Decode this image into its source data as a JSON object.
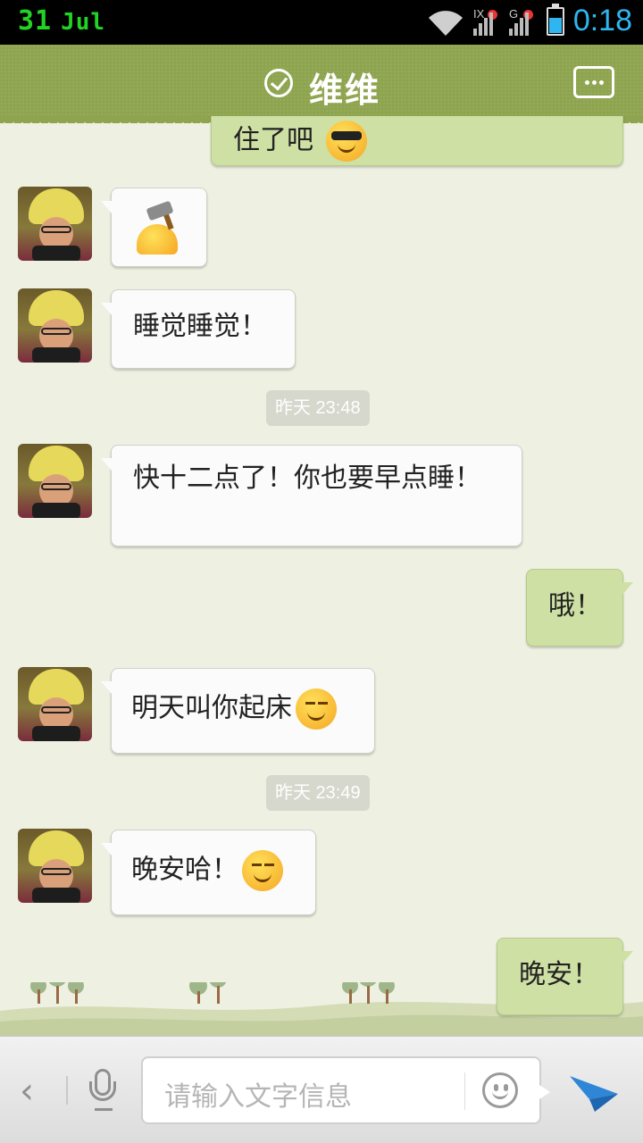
{
  "status_bar": {
    "date_day": "31",
    "date_month": "Jul",
    "signal_label_1": "IX",
    "signal_label_2": "G",
    "time": "0:18",
    "battery_level": 0.6
  },
  "header": {
    "contact_name": "维维",
    "verified_icon": "check-circle-icon",
    "menu_icon": "more-options-icon"
  },
  "messages": [
    {
      "side": "right",
      "text": "住了吧",
      "emoji": "cool-emoji",
      "partial": true
    },
    {
      "side": "left",
      "text": "",
      "emoji": "hammer-knock-emoji"
    },
    {
      "side": "left",
      "text": "睡觉睡觉！"
    },
    {
      "type": "timestamp",
      "text": "昨天 23:48"
    },
    {
      "side": "left",
      "text": "快十二点了！你也要早点睡！"
    },
    {
      "side": "right",
      "text": "哦！"
    },
    {
      "side": "left",
      "text": "明天叫你起床",
      "emoji": "sleepy-smile-emoji"
    },
    {
      "type": "timestamp",
      "text": "昨天 23:49"
    },
    {
      "side": "left",
      "text": "晚安哈！",
      "emoji": "content-smile-emoji"
    },
    {
      "side": "right",
      "text": "晚安！"
    }
  ],
  "input_bar": {
    "back_icon": "chevron-left-icon",
    "voice_icon": "microphone-icon",
    "placeholder": "请输入文字信息",
    "emoji_icon": "smiley-icon",
    "send_icon": "paper-plane-send-icon"
  },
  "colors": {
    "header_bg": "#8ea44f",
    "chat_bg": "#eef0e2",
    "sent_bubble": "#cfe0a4",
    "received_bubble": "#fbfbfb",
    "clock": "#2fb6f0",
    "date": "#23d323"
  }
}
